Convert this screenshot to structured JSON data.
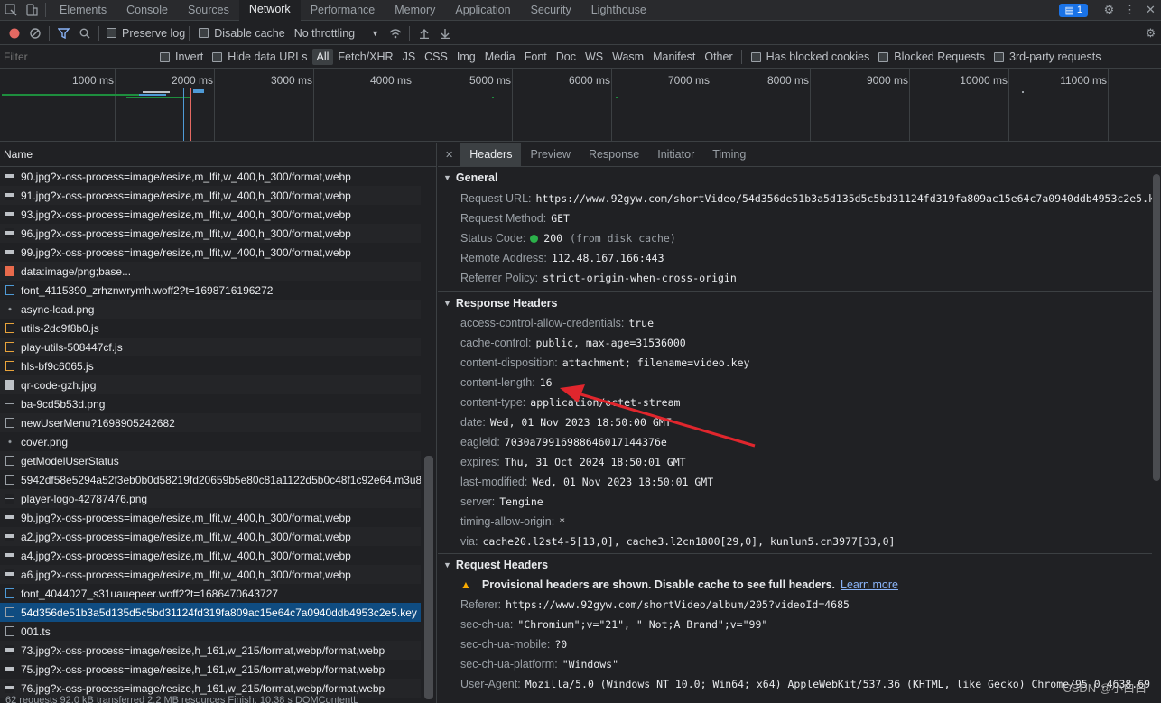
{
  "tabbar": {
    "tabs": [
      "Elements",
      "Console",
      "Sources",
      "Network",
      "Performance",
      "Memory",
      "Application",
      "Security",
      "Lighthouse"
    ],
    "active": "Network",
    "issues_count": "1"
  },
  "toolbar": {
    "preserve_log": "Preserve log",
    "disable_cache": "Disable cache",
    "throttling": "No throttling"
  },
  "filterbar": {
    "placeholder": "Filter",
    "invert": "Invert",
    "hide_data_urls": "Hide data URLs",
    "types": [
      "All",
      "Fetch/XHR",
      "JS",
      "CSS",
      "Img",
      "Media",
      "Font",
      "Doc",
      "WS",
      "Wasm",
      "Manifest",
      "Other"
    ],
    "has_blocked_cookies": "Has blocked cookies",
    "blocked_requests": "Blocked Requests",
    "third_party": "3rd-party requests"
  },
  "timeline": {
    "labels": [
      "1000 ms",
      "2000 ms",
      "3000 ms",
      "4000 ms",
      "5000 ms",
      "6000 ms",
      "7000 ms",
      "8000 ms",
      "9000 ms",
      "10000 ms",
      "11000 ms",
      "120"
    ]
  },
  "requests": {
    "header": "Name",
    "items": [
      {
        "name": "90.jpg?x-oss-process=image/resize,m_lfit,w_400,h_300/format,webp",
        "icon": "img"
      },
      {
        "name": "91.jpg?x-oss-process=image/resize,m_lfit,w_400,h_300/format,webp",
        "icon": "img"
      },
      {
        "name": "93.jpg?x-oss-process=image/resize,m_lfit,w_400,h_300/format,webp",
        "icon": "img"
      },
      {
        "name": "96.jpg?x-oss-process=image/resize,m_lfit,w_400,h_300/format,webp",
        "icon": "img"
      },
      {
        "name": "99.jpg?x-oss-process=image/resize,m_lfit,w_400,h_300/format,webp",
        "icon": "img"
      },
      {
        "name": "data:image/png;base...",
        "icon": "data"
      },
      {
        "name": "font_4115390_zrhznwrymh.woff2?t=1698716196272",
        "icon": "font"
      },
      {
        "name": "async-load.png",
        "icon": "dot"
      },
      {
        "name": "utils-2dc9f8b0.js",
        "icon": "js"
      },
      {
        "name": "play-utils-508447cf.js",
        "icon": "js"
      },
      {
        "name": "hls-bf9c6065.js",
        "icon": "js"
      },
      {
        "name": "qr-code-gzh.jpg",
        "icon": "png"
      },
      {
        "name": "ba-9cd5b53d.png",
        "icon": "dash"
      },
      {
        "name": "newUserMenu?1698905242682",
        "icon": "doc"
      },
      {
        "name": "cover.png",
        "icon": "dot"
      },
      {
        "name": "getModelUserStatus",
        "icon": "doc"
      },
      {
        "name": "5942df58e5294a52f3eb0b0d58219fd20659b5e80c81a1122d5b0c48f1c92e64.m3u8",
        "icon": "doc"
      },
      {
        "name": "player-logo-42787476.png",
        "icon": "dash"
      },
      {
        "name": "9b.jpg?x-oss-process=image/resize,m_lfit,w_400,h_300/format,webp",
        "icon": "img"
      },
      {
        "name": "a2.jpg?x-oss-process=image/resize,m_lfit,w_400,h_300/format,webp",
        "icon": "img"
      },
      {
        "name": "a4.jpg?x-oss-process=image/resize,m_lfit,w_400,h_300/format,webp",
        "icon": "img"
      },
      {
        "name": "a6.jpg?x-oss-process=image/resize,m_lfit,w_400,h_300/format,webp",
        "icon": "img"
      },
      {
        "name": "font_4044027_s31uauepeer.woff2?t=1686470643727",
        "icon": "font"
      },
      {
        "name": "54d356de51b3a5d135d5c5bd31124fd319fa809ac15e64c7a0940ddb4953c2e5.key",
        "icon": "doc",
        "selected": true
      },
      {
        "name": "001.ts",
        "icon": "doc"
      },
      {
        "name": "73.jpg?x-oss-process=image/resize,h_161,w_215/format,webp/format,webp",
        "icon": "img"
      },
      {
        "name": "75.jpg?x-oss-process=image/resize,h_161,w_215/format,webp/format,webp",
        "icon": "img"
      },
      {
        "name": "76.jpg?x-oss-process=image/resize,h_161,w_215/format,webp/format,webp",
        "icon": "img"
      }
    ],
    "status": "62 requests   92.0 kB transferred   2.2 MB resources   Finish: 10.38 s   DOMContentL"
  },
  "detail": {
    "tabs": [
      "Headers",
      "Preview",
      "Response",
      "Initiator",
      "Timing"
    ],
    "active": "Headers",
    "general": {
      "title": "General",
      "rows": [
        {
          "k": "Request URL:",
          "v": "https://www.92gyw.com/shortVideo/54d356de51b3a5d135d5c5bd31124fd319fa809ac15e64c7a0940ddb4953c2e5.key"
        },
        {
          "k": "Request Method:",
          "v": "GET"
        },
        {
          "k": "Status Code:",
          "v": "200",
          "note": "(from disk cache)",
          "dot": true
        },
        {
          "k": "Remote Address:",
          "v": "112.48.167.166:443"
        },
        {
          "k": "Referrer Policy:",
          "v": "strict-origin-when-cross-origin"
        }
      ]
    },
    "response": {
      "title": "Response Headers",
      "rows": [
        {
          "k": "access-control-allow-credentials:",
          "v": "true"
        },
        {
          "k": "cache-control:",
          "v": "public, max-age=31536000"
        },
        {
          "k": "content-disposition:",
          "v": "attachment; filename=video.key"
        },
        {
          "k": "content-length:",
          "v": "16"
        },
        {
          "k": "content-type:",
          "v": "application/octet-stream"
        },
        {
          "k": "date:",
          "v": "Wed, 01 Nov 2023 18:50:00 GMT"
        },
        {
          "k": "eagleid:",
          "v": "7030a79916988646017144376e"
        },
        {
          "k": "expires:",
          "v": "Thu, 31 Oct 2024 18:50:01 GMT"
        },
        {
          "k": "last-modified:",
          "v": "Wed, 01 Nov 2023 18:50:01 GMT"
        },
        {
          "k": "server:",
          "v": "Tengine"
        },
        {
          "k": "timing-allow-origin:",
          "v": "*"
        },
        {
          "k": "via:",
          "v": "cache20.l2st4-5[13,0], cache3.l2cn1800[29,0], kunlun5.cn3977[33,0]"
        }
      ]
    },
    "request": {
      "title": "Request Headers",
      "warning": "Provisional headers are shown. Disable cache to see full headers.",
      "learn_more": "Learn more",
      "rows": [
        {
          "k": "Referer:",
          "v": "https://www.92gyw.com/shortVideo/album/205?videoId=4685"
        },
        {
          "k": "sec-ch-ua:",
          "v": "\"Chromium\";v=\"21\", \" Not;A Brand\";v=\"99\""
        },
        {
          "k": "sec-ch-ua-mobile:",
          "v": "?0"
        },
        {
          "k": "sec-ch-ua-platform:",
          "v": "\"Windows\""
        },
        {
          "k": "User-Agent:",
          "v": "Mozilla/5.0 (Windows NT 10.0; Win64; x64) AppleWebKit/537.36 (KHTML, like Gecko) Chrome/95.0.4638.69 Saf"
        }
      ]
    }
  },
  "watermark": "CSDN @小白白",
  "colors": {
    "accent": "#1a73e8",
    "selected_row": "#0f4c81",
    "arrow": "#e0262d",
    "status_ok": "#2bb14a"
  }
}
